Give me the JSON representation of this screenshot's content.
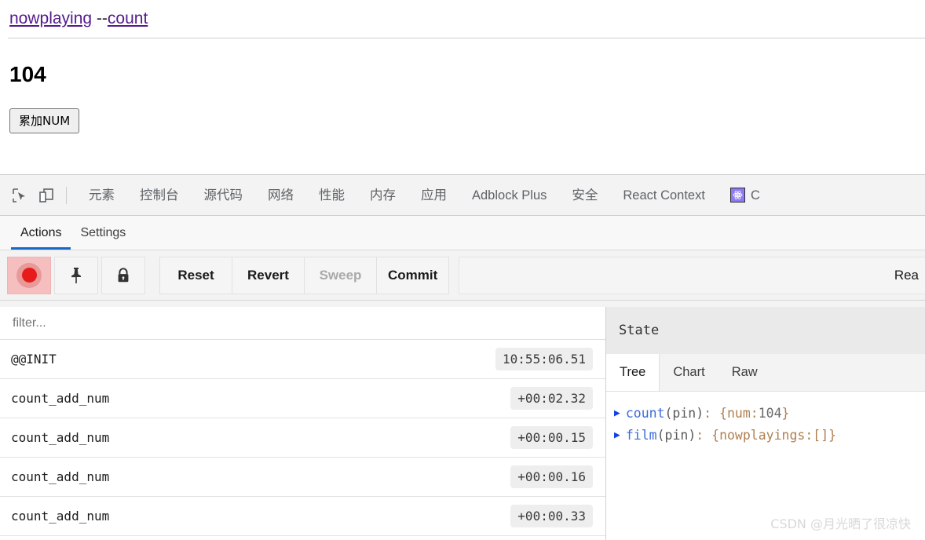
{
  "page": {
    "links": [
      {
        "label": "nowplaying",
        "name": "nav-link-nowplaying"
      },
      {
        "label": "count",
        "name": "nav-link-count"
      }
    ],
    "link_separator": " --",
    "count_value": "104",
    "add_button_label": "累加NUM"
  },
  "devtools": {
    "icons": {
      "inspect": "inspect-element-icon",
      "device": "device-toolbar-icon"
    },
    "tabs": [
      "元素",
      "控制台",
      "源代码",
      "网络",
      "性能",
      "内存",
      "应用",
      "Adblock Plus",
      "安全",
      "React Context"
    ],
    "overflow_tab_label": "C"
  },
  "redux": {
    "subtabs": [
      {
        "label": "Actions",
        "active": true
      },
      {
        "label": "Settings",
        "active": false
      }
    ],
    "toolbar": {
      "record_label": "record-toggle",
      "pin_label": "pin-toggle",
      "lock_label": "lock-toggle",
      "buttons": [
        {
          "label": "Reset",
          "disabled": false
        },
        {
          "label": "Revert",
          "disabled": false
        },
        {
          "label": "Sweep",
          "disabled": true
        },
        {
          "label": "Commit",
          "disabled": false
        }
      ],
      "slot_text": "Rea"
    },
    "filter": {
      "placeholder": "filter...",
      "value": ""
    },
    "actions": [
      {
        "name": "@@INIT",
        "time": "10:55:06.51"
      },
      {
        "name": "count_add_num",
        "time": "+00:02.32"
      },
      {
        "name": "count_add_num",
        "time": "+00:00.15"
      },
      {
        "name": "count_add_num",
        "time": "+00:00.16"
      },
      {
        "name": "count_add_num",
        "time": "+00:00.33"
      }
    ],
    "state": {
      "title": "State",
      "tabs": [
        {
          "label": "Tree",
          "active": true
        },
        {
          "label": "Chart",
          "active": false
        },
        {
          "label": "Raw",
          "active": false
        }
      ],
      "tree": [
        {
          "key": "count",
          "pin": " (pin)",
          "open": ": {",
          "prop": " num:",
          "value": " 104",
          "close": " }"
        },
        {
          "key": "film",
          "pin": " (pin)",
          "open": ": {",
          "prop": " nowplayings:",
          "value": " []",
          "close": " }"
        }
      ]
    }
  },
  "watermark": "CSDN @月光晒了很凉快",
  "colors": {
    "accent_blue": "#1769c9",
    "link_purple": "#551a8b",
    "record_red": "#e81b1b",
    "react_purple": "#8d7bf5"
  }
}
